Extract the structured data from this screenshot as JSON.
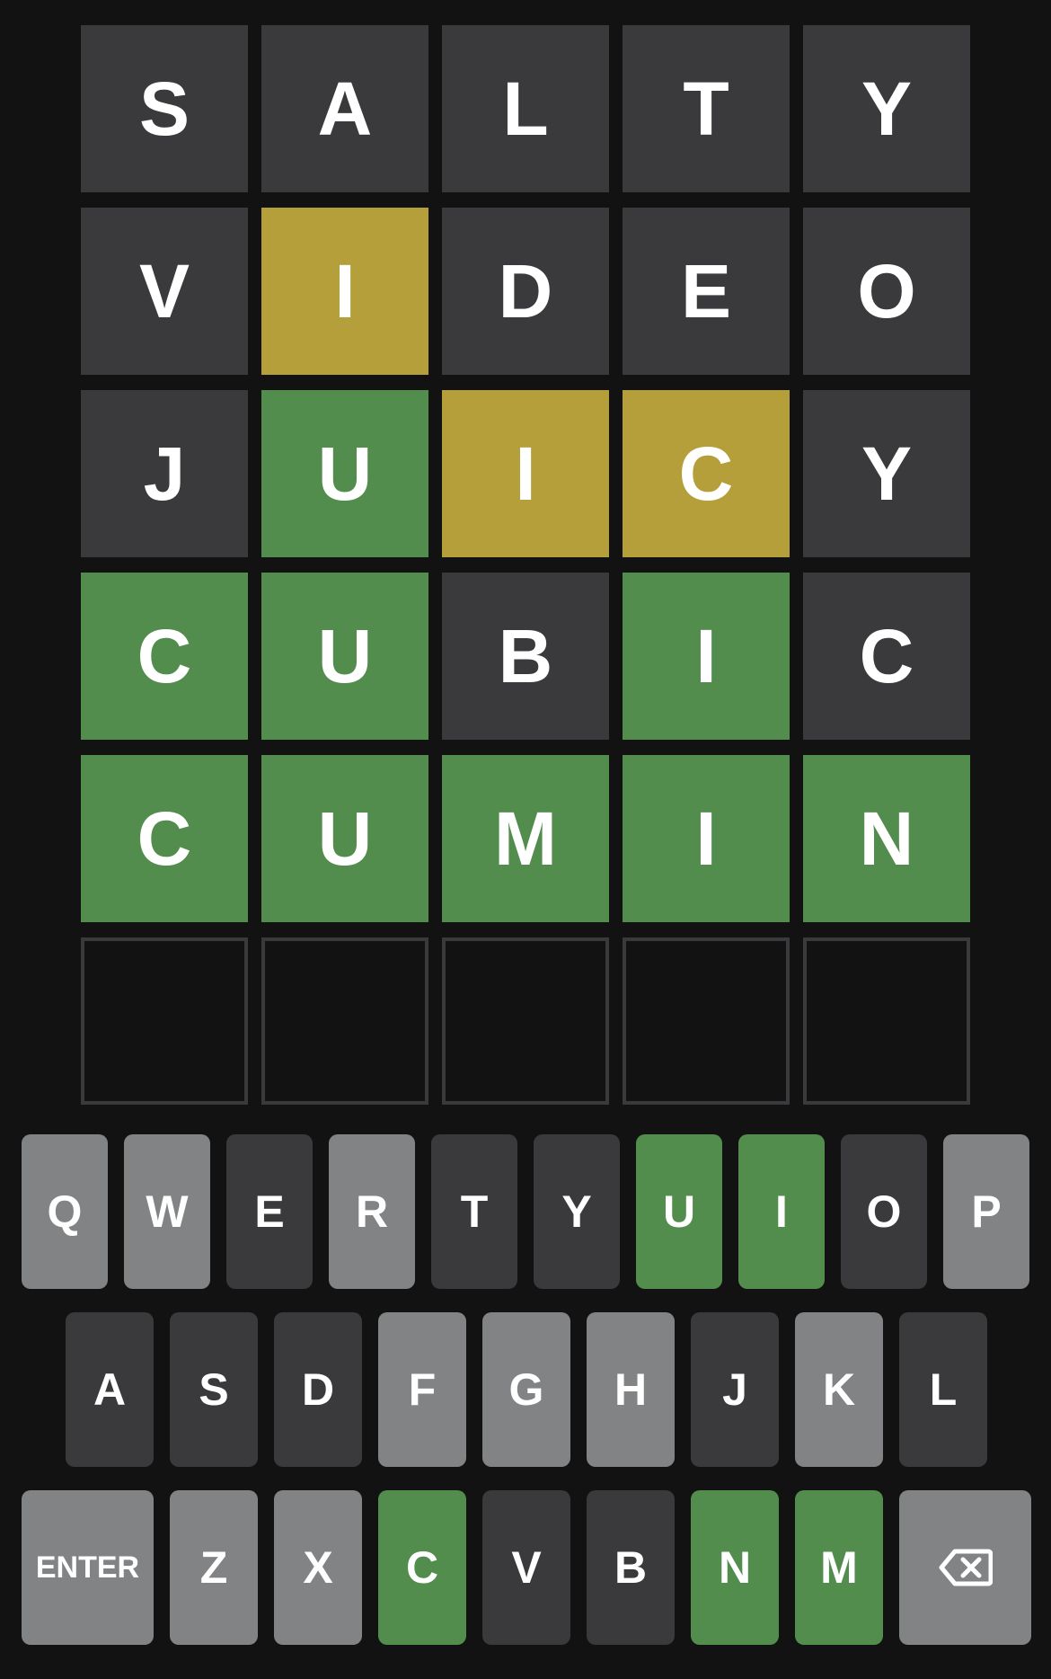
{
  "colors": {
    "background": "#121213",
    "absent": "#3a3a3c",
    "present": "#b59f3b",
    "correct": "#538d4e",
    "unused": "#818384",
    "text": "#ffffff"
  },
  "board": {
    "rows": [
      [
        {
          "letter": "S",
          "state": "absent"
        },
        {
          "letter": "A",
          "state": "absent"
        },
        {
          "letter": "L",
          "state": "absent"
        },
        {
          "letter": "T",
          "state": "absent"
        },
        {
          "letter": "Y",
          "state": "absent"
        }
      ],
      [
        {
          "letter": "V",
          "state": "absent"
        },
        {
          "letter": "I",
          "state": "present"
        },
        {
          "letter": "D",
          "state": "absent"
        },
        {
          "letter": "E",
          "state": "absent"
        },
        {
          "letter": "O",
          "state": "absent"
        }
      ],
      [
        {
          "letter": "J",
          "state": "absent"
        },
        {
          "letter": "U",
          "state": "correct"
        },
        {
          "letter": "I",
          "state": "present"
        },
        {
          "letter": "C",
          "state": "present"
        },
        {
          "letter": "Y",
          "state": "absent"
        }
      ],
      [
        {
          "letter": "C",
          "state": "correct"
        },
        {
          "letter": "U",
          "state": "correct"
        },
        {
          "letter": "B",
          "state": "absent"
        },
        {
          "letter": "I",
          "state": "correct"
        },
        {
          "letter": "C",
          "state": "absent"
        }
      ],
      [
        {
          "letter": "C",
          "state": "correct"
        },
        {
          "letter": "U",
          "state": "correct"
        },
        {
          "letter": "M",
          "state": "correct"
        },
        {
          "letter": "I",
          "state": "correct"
        },
        {
          "letter": "N",
          "state": "correct"
        }
      ],
      [
        {
          "letter": "",
          "state": "empty"
        },
        {
          "letter": "",
          "state": "empty"
        },
        {
          "letter": "",
          "state": "empty"
        },
        {
          "letter": "",
          "state": "empty"
        },
        {
          "letter": "",
          "state": "empty"
        }
      ]
    ]
  },
  "keyboard": {
    "rows": [
      [
        {
          "label": "Q",
          "state": "unused"
        },
        {
          "label": "W",
          "state": "unused"
        },
        {
          "label": "E",
          "state": "absent"
        },
        {
          "label": "R",
          "state": "unused"
        },
        {
          "label": "T",
          "state": "absent"
        },
        {
          "label": "Y",
          "state": "absent"
        },
        {
          "label": "U",
          "state": "correct"
        },
        {
          "label": "I",
          "state": "correct"
        },
        {
          "label": "O",
          "state": "absent"
        },
        {
          "label": "P",
          "state": "unused"
        }
      ],
      [
        {
          "label": "A",
          "state": "absent"
        },
        {
          "label": "S",
          "state": "absent"
        },
        {
          "label": "D",
          "state": "absent"
        },
        {
          "label": "F",
          "state": "unused"
        },
        {
          "label": "G",
          "state": "unused"
        },
        {
          "label": "H",
          "state": "unused"
        },
        {
          "label": "J",
          "state": "absent"
        },
        {
          "label": "K",
          "state": "unused"
        },
        {
          "label": "L",
          "state": "absent"
        }
      ],
      [
        {
          "label": "ENTER",
          "state": "unused",
          "kind": "enter"
        },
        {
          "label": "Z",
          "state": "unused"
        },
        {
          "label": "X",
          "state": "unused"
        },
        {
          "label": "C",
          "state": "correct"
        },
        {
          "label": "V",
          "state": "absent"
        },
        {
          "label": "B",
          "state": "absent"
        },
        {
          "label": "N",
          "state": "correct"
        },
        {
          "label": "M",
          "state": "correct"
        },
        {
          "label": "",
          "state": "unused",
          "kind": "backspace",
          "icon": "backspace-icon"
        }
      ]
    ]
  }
}
